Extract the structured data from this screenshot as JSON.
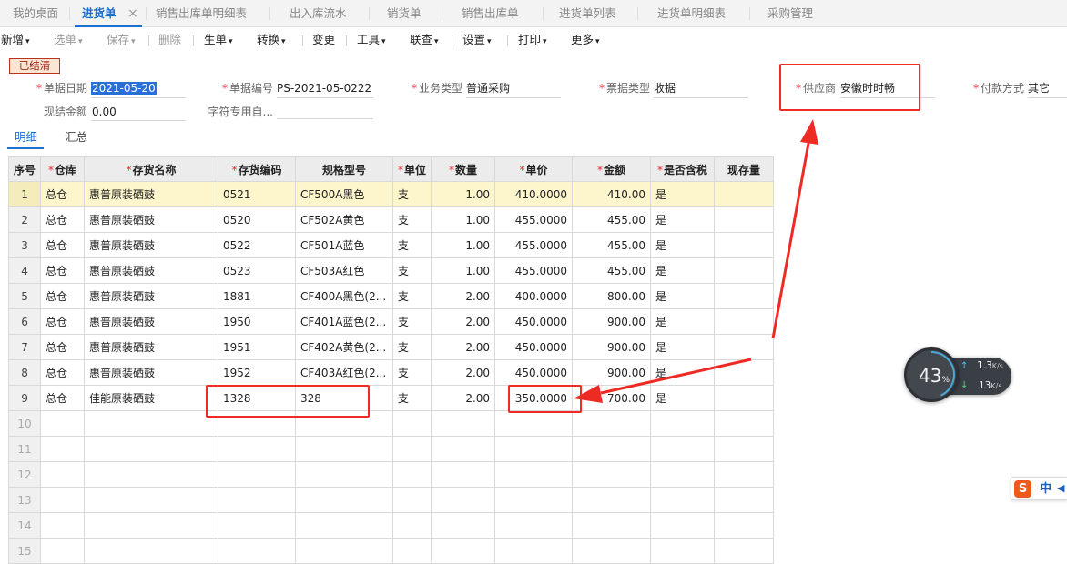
{
  "tabs": [
    {
      "label": "我的桌面",
      "active": false
    },
    {
      "label": "进货单",
      "active": true
    },
    {
      "label": "销售出库单明细表",
      "active": false
    },
    {
      "label": "出入库流水",
      "active": false
    },
    {
      "label": "销货单",
      "active": false
    },
    {
      "label": "销售出库单",
      "active": false
    },
    {
      "label": "进货单列表",
      "active": false
    },
    {
      "label": "进货单明细表",
      "active": false
    },
    {
      "label": "采购管理",
      "active": false
    }
  ],
  "tab_close_glyph": "×",
  "toolbar": {
    "new": "新增",
    "select": "选单",
    "save": "保存",
    "delete": "删除",
    "generate": "生单",
    "convert": "转换",
    "change": "变更",
    "tools": "工具",
    "linked": "联查",
    "settings": "设置",
    "print": "打印",
    "more": "更多",
    "caret": "▾"
  },
  "status_stamp": "已结清",
  "required_mark": "*",
  "form": {
    "doc_date": {
      "label": "单据日期",
      "value": "2021-05-20"
    },
    "doc_no": {
      "label": "单据编号",
      "value": "PS-2021-05-0222"
    },
    "biz_type": {
      "label": "业务类型",
      "value": "普通采购"
    },
    "invoice_type": {
      "label": "票据类型",
      "value": "收据"
    },
    "supplier": {
      "label": "供应商",
      "value": "安徽时时畅"
    },
    "payment": {
      "label": "付款方式",
      "value": "其它"
    },
    "cash_amount": {
      "label": "现结金额",
      "value": "0.00"
    },
    "char_field": {
      "label": "字符专用自...",
      "value": ""
    }
  },
  "subtabs": [
    "明细",
    "汇总"
  ],
  "grid": {
    "headers": [
      {
        "label": "序号",
        "required": false
      },
      {
        "label": "仓库",
        "required": true
      },
      {
        "label": "存货名称",
        "required": true
      },
      {
        "label": "存货编码",
        "required": true
      },
      {
        "label": "规格型号",
        "required": false
      },
      {
        "label": "单位",
        "required": true
      },
      {
        "label": "数量",
        "required": true
      },
      {
        "label": "单价",
        "required": true
      },
      {
        "label": "金额",
        "required": true
      },
      {
        "label": "是否含税",
        "required": true
      },
      {
        "label": "现存量",
        "required": false
      }
    ],
    "rows": [
      [
        "1",
        "总仓",
        "惠普原装硒鼓",
        "0521",
        "CF500A黑色",
        "支",
        "1.00",
        "410.0000",
        "410.00",
        "是",
        ""
      ],
      [
        "2",
        "总仓",
        "惠普原装硒鼓",
        "0520",
        "CF502A黄色",
        "支",
        "1.00",
        "455.0000",
        "455.00",
        "是",
        ""
      ],
      [
        "3",
        "总仓",
        "惠普原装硒鼓",
        "0522",
        "CF501A蓝色",
        "支",
        "1.00",
        "455.0000",
        "455.00",
        "是",
        ""
      ],
      [
        "4",
        "总仓",
        "惠普原装硒鼓",
        "0523",
        "CF503A红色",
        "支",
        "1.00",
        "455.0000",
        "455.00",
        "是",
        ""
      ],
      [
        "5",
        "总仓",
        "惠普原装硒鼓",
        "1881",
        "CF400A黑色(2...",
        "支",
        "2.00",
        "400.0000",
        "800.00",
        "是",
        ""
      ],
      [
        "6",
        "总仓",
        "惠普原装硒鼓",
        "1950",
        "CF401A蓝色(2...",
        "支",
        "2.00",
        "450.0000",
        "900.00",
        "是",
        ""
      ],
      [
        "7",
        "总仓",
        "惠普原装硒鼓",
        "1951",
        "CF402A黄色(2...",
        "支",
        "2.00",
        "450.0000",
        "900.00",
        "是",
        ""
      ],
      [
        "8",
        "总仓",
        "惠普原装硒鼓",
        "1952",
        "CF403A红色(2...",
        "支",
        "2.00",
        "450.0000",
        "900.00",
        "是",
        ""
      ],
      [
        "9",
        "总仓",
        "佳能原装硒鼓",
        "1328",
        "328",
        "支",
        "2.00",
        "350.0000",
        "700.00",
        "是",
        ""
      ],
      [
        "10",
        "",
        "",
        "",
        "",
        "",
        "",
        "",
        "",
        "",
        ""
      ],
      [
        "11",
        "",
        "",
        "",
        "",
        "",
        "",
        "",
        "",
        "",
        ""
      ],
      [
        "12",
        "",
        "",
        "",
        "",
        "",
        "",
        "",
        "",
        "",
        ""
      ],
      [
        "13",
        "",
        "",
        "",
        "",
        "",
        "",
        "",
        "",
        "",
        ""
      ],
      [
        "14",
        "",
        "",
        "",
        "",
        "",
        "",
        "",
        "",
        "",
        ""
      ],
      [
        "15",
        "",
        "",
        "",
        "",
        "",
        "",
        "",
        "",
        "",
        ""
      ]
    ],
    "selected_row": 0
  },
  "net_widget": {
    "cpu_percent": "43",
    "percent_sign": "%",
    "upload": "1.3",
    "download": "13",
    "unit": "K/s"
  },
  "ime": {
    "logo": "S",
    "lang": "中",
    "extra": "◀"
  },
  "colors": {
    "accent": "#1a6fd0",
    "annotation": "#ee2a24",
    "required": "#e23",
    "selected_row": "#fdf6cc"
  }
}
